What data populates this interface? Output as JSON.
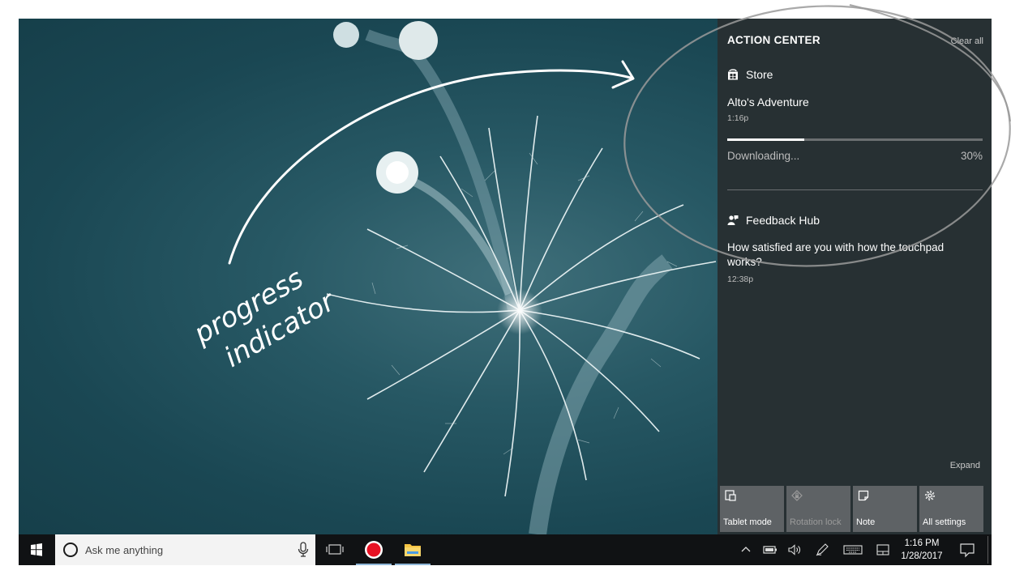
{
  "annotation": {
    "label_line1": "progress",
    "label_line2": "indicator"
  },
  "action_center": {
    "title": "ACTION CENTER",
    "clear_all": "Clear all",
    "expand": "Expand",
    "groups": [
      {
        "app": "Store",
        "icon": "store-icon",
        "title": "Alto's Adventure",
        "time": "1:16p",
        "progress": {
          "status": "Downloading...",
          "percent_text": "30%",
          "value": 0.3
        }
      },
      {
        "app": "Feedback Hub",
        "icon": "feedback-hub-icon",
        "body": "How satisfied are you with how the touchpad works?",
        "time": "12:38p"
      }
    ],
    "quick_actions": [
      {
        "label": "Tablet mode",
        "icon": "tablet-mode-icon",
        "enabled": true
      },
      {
        "label": "Rotation lock",
        "icon": "rotation-lock-icon",
        "enabled": false
      },
      {
        "label": "Note",
        "icon": "note-icon",
        "enabled": true
      },
      {
        "label": "All settings",
        "icon": "gear-icon",
        "enabled": true
      }
    ]
  },
  "taskbar": {
    "search_placeholder": "Ask me anything",
    "clock_time": "1:16 PM",
    "clock_date": "1/28/2017",
    "colors": {
      "record_red": "#e81123",
      "folder_yellow": "#f6c443",
      "taskbar_bg": "#101214"
    }
  }
}
